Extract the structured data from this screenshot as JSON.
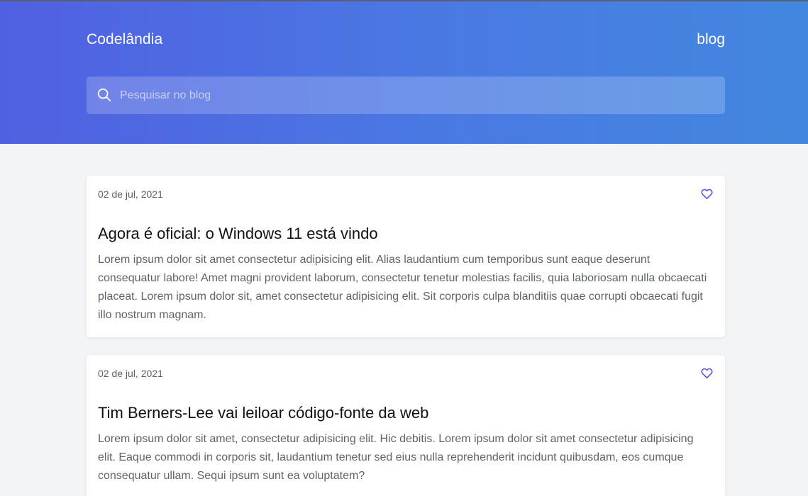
{
  "header": {
    "brand": "Codelândia",
    "nav_blog": "blog",
    "search": {
      "placeholder": "Pesquisar no blog",
      "icon": "search-icon"
    }
  },
  "posts": [
    {
      "date": "02 de jul, 2021",
      "title": "Agora é oficial: o Windows 11 está vindo",
      "text": "Lorem ipsum dolor sit amet consectetur adipisicing elit. Alias laudantium cum temporibus sunt eaque deserunt consequatur labore! Amet magni provident laborum, consectetur tenetur molestias facilis, quia laboriosam nulla obcaecati placeat. Lorem ipsum dolor sit, amet consectetur adipisicing elit. Sit corporis culpa blanditiis quae corrupti obcaecati fugit illo nostrum magnam.",
      "icon": "heart-icon"
    },
    {
      "date": "02 de jul, 2021",
      "title": "Tim Berners-Lee vai leiloar código-fonte da web",
      "text": "Lorem ipsum dolor sit amet, consectetur adipisicing elit. Hic debitis. Lorem ipsum dolor sit amet consectetur adipisicing elit. Eaque commodi in corporis sit, laudantium tenetur sed eius nulla reprehenderit incidunt quibusdam, eos cumque consequatur ullam. Sequi ipsum sunt ea voluptatem?",
      "icon": "heart-icon"
    }
  ],
  "colors": {
    "header_gradient_start": "#5060e2",
    "header_gradient_end": "#4287df",
    "accent_heart": "#5b4fd8",
    "background": "#f3f4f6"
  }
}
